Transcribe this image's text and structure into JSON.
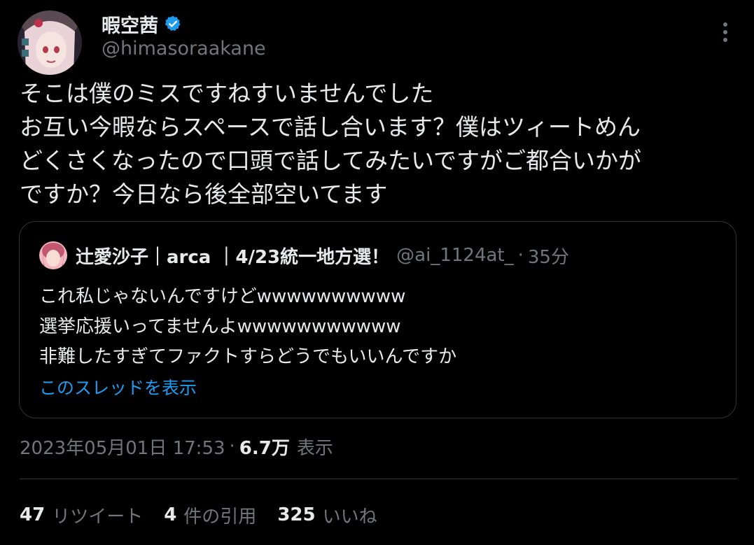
{
  "author": {
    "display_name": "暇空茜",
    "handle": "@himasoraakane",
    "verified": true,
    "verified_color": "#1d9bf0"
  },
  "tweet": {
    "lines": [
      "そこは僕のミスですねすいませんでした",
      "お互い今暇ならスペースで話し合います？僕はツィートめん",
      "どくさくなったので口頭で話してみたいですがご都合いかが",
      "ですか？今日なら後全部空いてます"
    ]
  },
  "quote": {
    "display_name": "辻愛沙子｜arca ｜4/23統一地方選！",
    "handle": "@ai_1124at_",
    "separator": "·",
    "time": "35分",
    "lines": [
      "これ私じゃないんですけどwwwwwwwwww",
      "選挙応援いってませんよwwwwwwwwwww",
      "非難したすぎてファクトすらどうでもいいんですか"
    ],
    "thread_link": "このスレッドを表示"
  },
  "meta": {
    "timestamp": "2023年05月01日 17:53",
    "dot": "·",
    "views_count": "6.7万",
    "views_label": "表示"
  },
  "stats": {
    "retweets_count": "47",
    "retweets_label": "リツイート",
    "quotes_count": "4",
    "quotes_label": "件の引用",
    "likes_count": "325",
    "likes_label": "いいね"
  },
  "colors": {
    "background": "#000000",
    "text_primary": "#e7e9ea",
    "text_secondary": "#71767b",
    "link": "#1d9bf0",
    "border": "#2f3336"
  },
  "icons": {
    "verified": "verified-badge-icon",
    "more": "more-options-icon"
  }
}
